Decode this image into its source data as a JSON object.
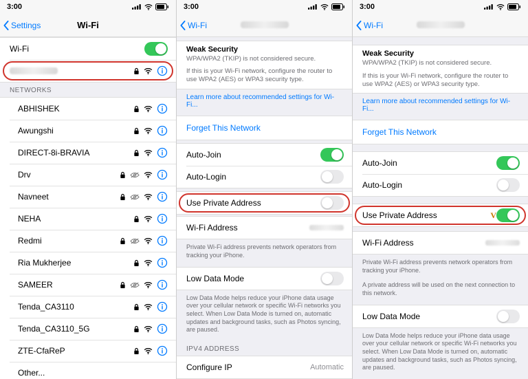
{
  "status": {
    "time": "3:00"
  },
  "p1": {
    "back": "Settings",
    "title": "Wi-Fi",
    "wifi_switch_label": "Wi-Fi",
    "networks_header": "NETWORKS",
    "other": "Other...",
    "networks": [
      "ABHISHEK",
      "Awungshi",
      "DIRECT-8i-BRAVIA",
      "Drv",
      "Navneet",
      "NEHA",
      "Redmi",
      "Ria Mukherjee",
      "SAMEER",
      "Tenda_CA3110",
      "Tenda_CA3110_5G",
      "ZTE-CfaReP"
    ]
  },
  "detail": {
    "back": "Wi-Fi",
    "weak_title": "Weak Security",
    "weak_line1": "WPA/WPA2 (TKIP) is not considered secure.",
    "weak_line2": "If this is your Wi-Fi network, configure the router to use WPA2 (AES) or WPA3 security type.",
    "learn_more": "Learn more about recommended settings for Wi-Fi...",
    "forget": "Forget This Network",
    "auto_join": "Auto-Join",
    "auto_login": "Auto-Login",
    "private_addr": "Use Private Address",
    "wifi_addr": "Wi-Fi Address",
    "private_footer_off": "Private Wi-Fi address prevents network operators from tracking your iPhone.",
    "private_footer_on_a": "Private Wi-Fi address prevents network operators from tracking your iPhone.",
    "private_footer_on_b": "A private address will be used on the next connection to this network.",
    "low_data": "Low Data Mode",
    "low_data_footer": "Low Data Mode helps reduce your iPhone data usage over your cellular network or specific Wi-Fi networks you select. When Low Data Mode is turned on, automatic updates and background tasks, such as Photos syncing, are paused.",
    "ipv4_header": "IPV4 ADDRESS",
    "configure_ip": "Configure IP",
    "configure_ip_value": "Automatic"
  }
}
